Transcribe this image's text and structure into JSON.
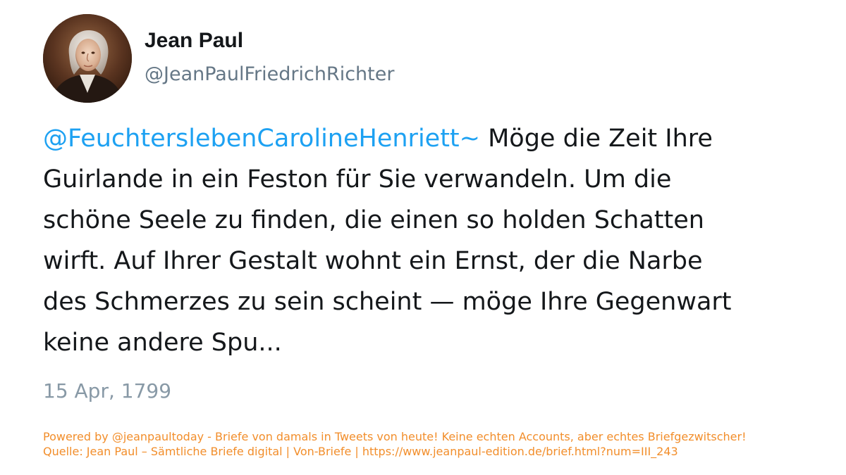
{
  "author": {
    "name": "Jean Paul",
    "handle": "@JeanPaulFriedrichRichter"
  },
  "tweet": {
    "mention": "@FeuchterslebenCarolineHenriett~",
    "text": " Möge die Zeit Ihre\nGuirlande in ein Feston für Sie verwandeln. Um die\nschöne Seele zu finden, die einen so holden Schatten\nwirft. Auf Ihrer Gestalt wohnt ein Ernst, der die Narbe\ndes Schmerzes zu sein scheint — möge Ihre Gegenwart\nkeine andere Spu...",
    "date": "15 Apr, 1799"
  },
  "footer": {
    "line1": "Powered by @jeanpaultoday - Briefe von damals in Tweets von heute! Keine echten Accounts, aber echtes Briefgezwitscher!",
    "line2": "Quelle: Jean Paul – Sämtliche Briefe digital | Von-Briefe | https://www.jeanpaul-edition.de/brief.html?num=III_243"
  },
  "colors": {
    "text": "#14171a",
    "mention": "#1da1f2",
    "handle": "#657786",
    "date": "#8899a6",
    "footer": "#f28e2b"
  }
}
